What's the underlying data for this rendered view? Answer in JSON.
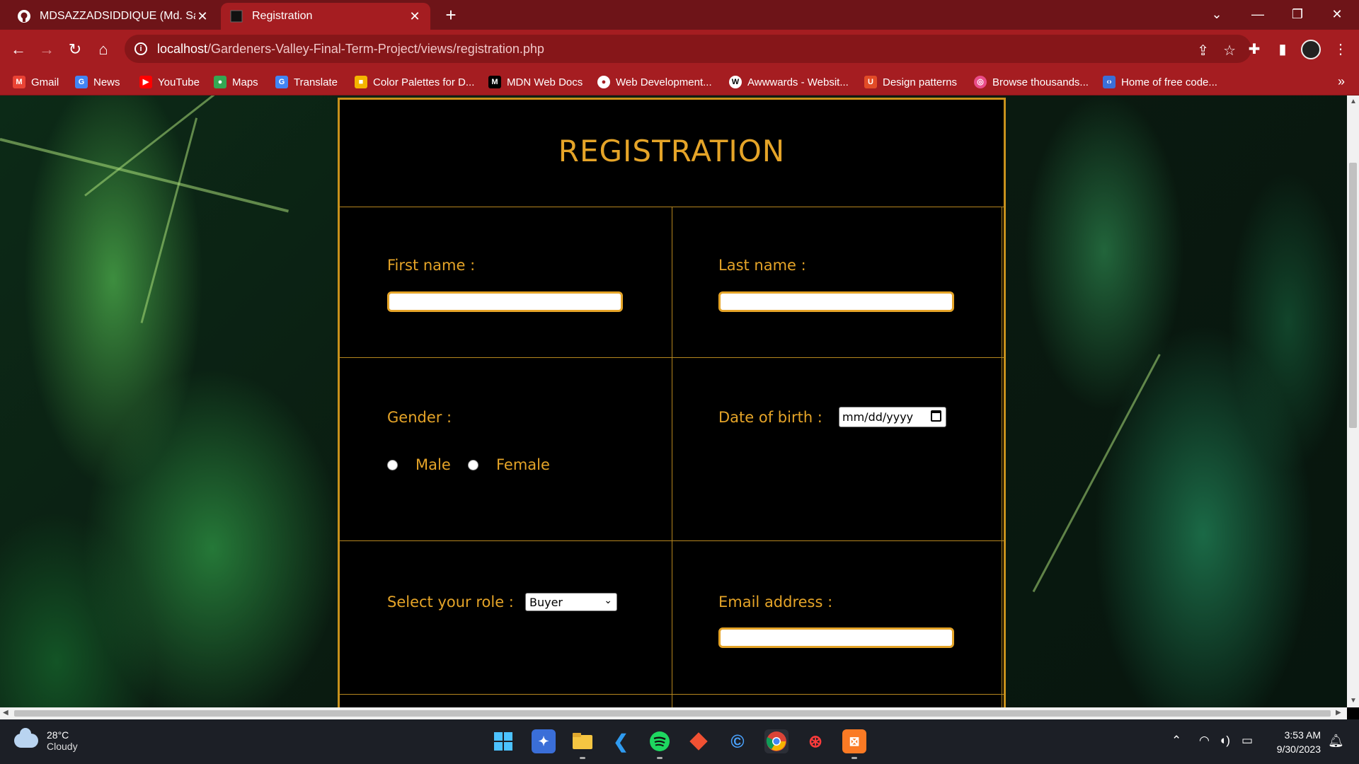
{
  "browser": {
    "tabs": [
      {
        "title": "MDSAZZADSIDDIQUE (Md. Sazz",
        "active": false,
        "icon": "github-icon"
      },
      {
        "title": "Registration",
        "active": true,
        "icon": "page-icon"
      }
    ],
    "url_host": "localhost",
    "url_path": "/Gardeners-Valley-Final-Term-Project/views/registration.php",
    "bookmarks": [
      {
        "label": "Gmail",
        "icon": "gmail-icon",
        "color": "#ea4335"
      },
      {
        "label": "News",
        "icon": "google-news-icon",
        "color": "#4285f4"
      },
      {
        "label": "YouTube",
        "icon": "youtube-icon",
        "color": "#ff0000"
      },
      {
        "label": "Maps",
        "icon": "maps-icon",
        "color": "#34a853"
      },
      {
        "label": "Translate",
        "icon": "translate-icon",
        "color": "#4285f4"
      },
      {
        "label": "Color Palettes for D...",
        "icon": "palette-icon",
        "color": "#f4b400"
      },
      {
        "label": "MDN Web Docs",
        "icon": "mdn-icon",
        "color": "#000000"
      },
      {
        "label": "Web Development...",
        "icon": "webdev-icon",
        "color": "#ffffff"
      },
      {
        "label": "Awwwards - Websit...",
        "icon": "awwwards-icon",
        "color": "#ffffff"
      },
      {
        "label": "Design patterns",
        "icon": "ui-icon",
        "color": "#e24c27"
      },
      {
        "label": "Browse thousands...",
        "icon": "dribbble-icon",
        "color": "#ea4c89"
      },
      {
        "label": "Home of free code...",
        "icon": "code-icon",
        "color": "#3b6fd8"
      }
    ]
  },
  "form": {
    "title": "REGISTRATION",
    "first_name_label": "First name :",
    "last_name_label": "Last name :",
    "gender_label": "Gender :",
    "gender_options": [
      "Male",
      "Female"
    ],
    "dob_label": "Date of birth :",
    "dob_placeholder": "mm/dd/yyyy",
    "role_label": "Select your role :",
    "role_selected": "Buyer",
    "email_label": "Email address :"
  },
  "taskbar": {
    "weather_temp": "28°C",
    "weather_desc": "Cloudy",
    "time": "3:53 AM",
    "date": "9/30/2023"
  },
  "colors": {
    "accent": "#e5a428",
    "chrome": "#a51d21"
  }
}
